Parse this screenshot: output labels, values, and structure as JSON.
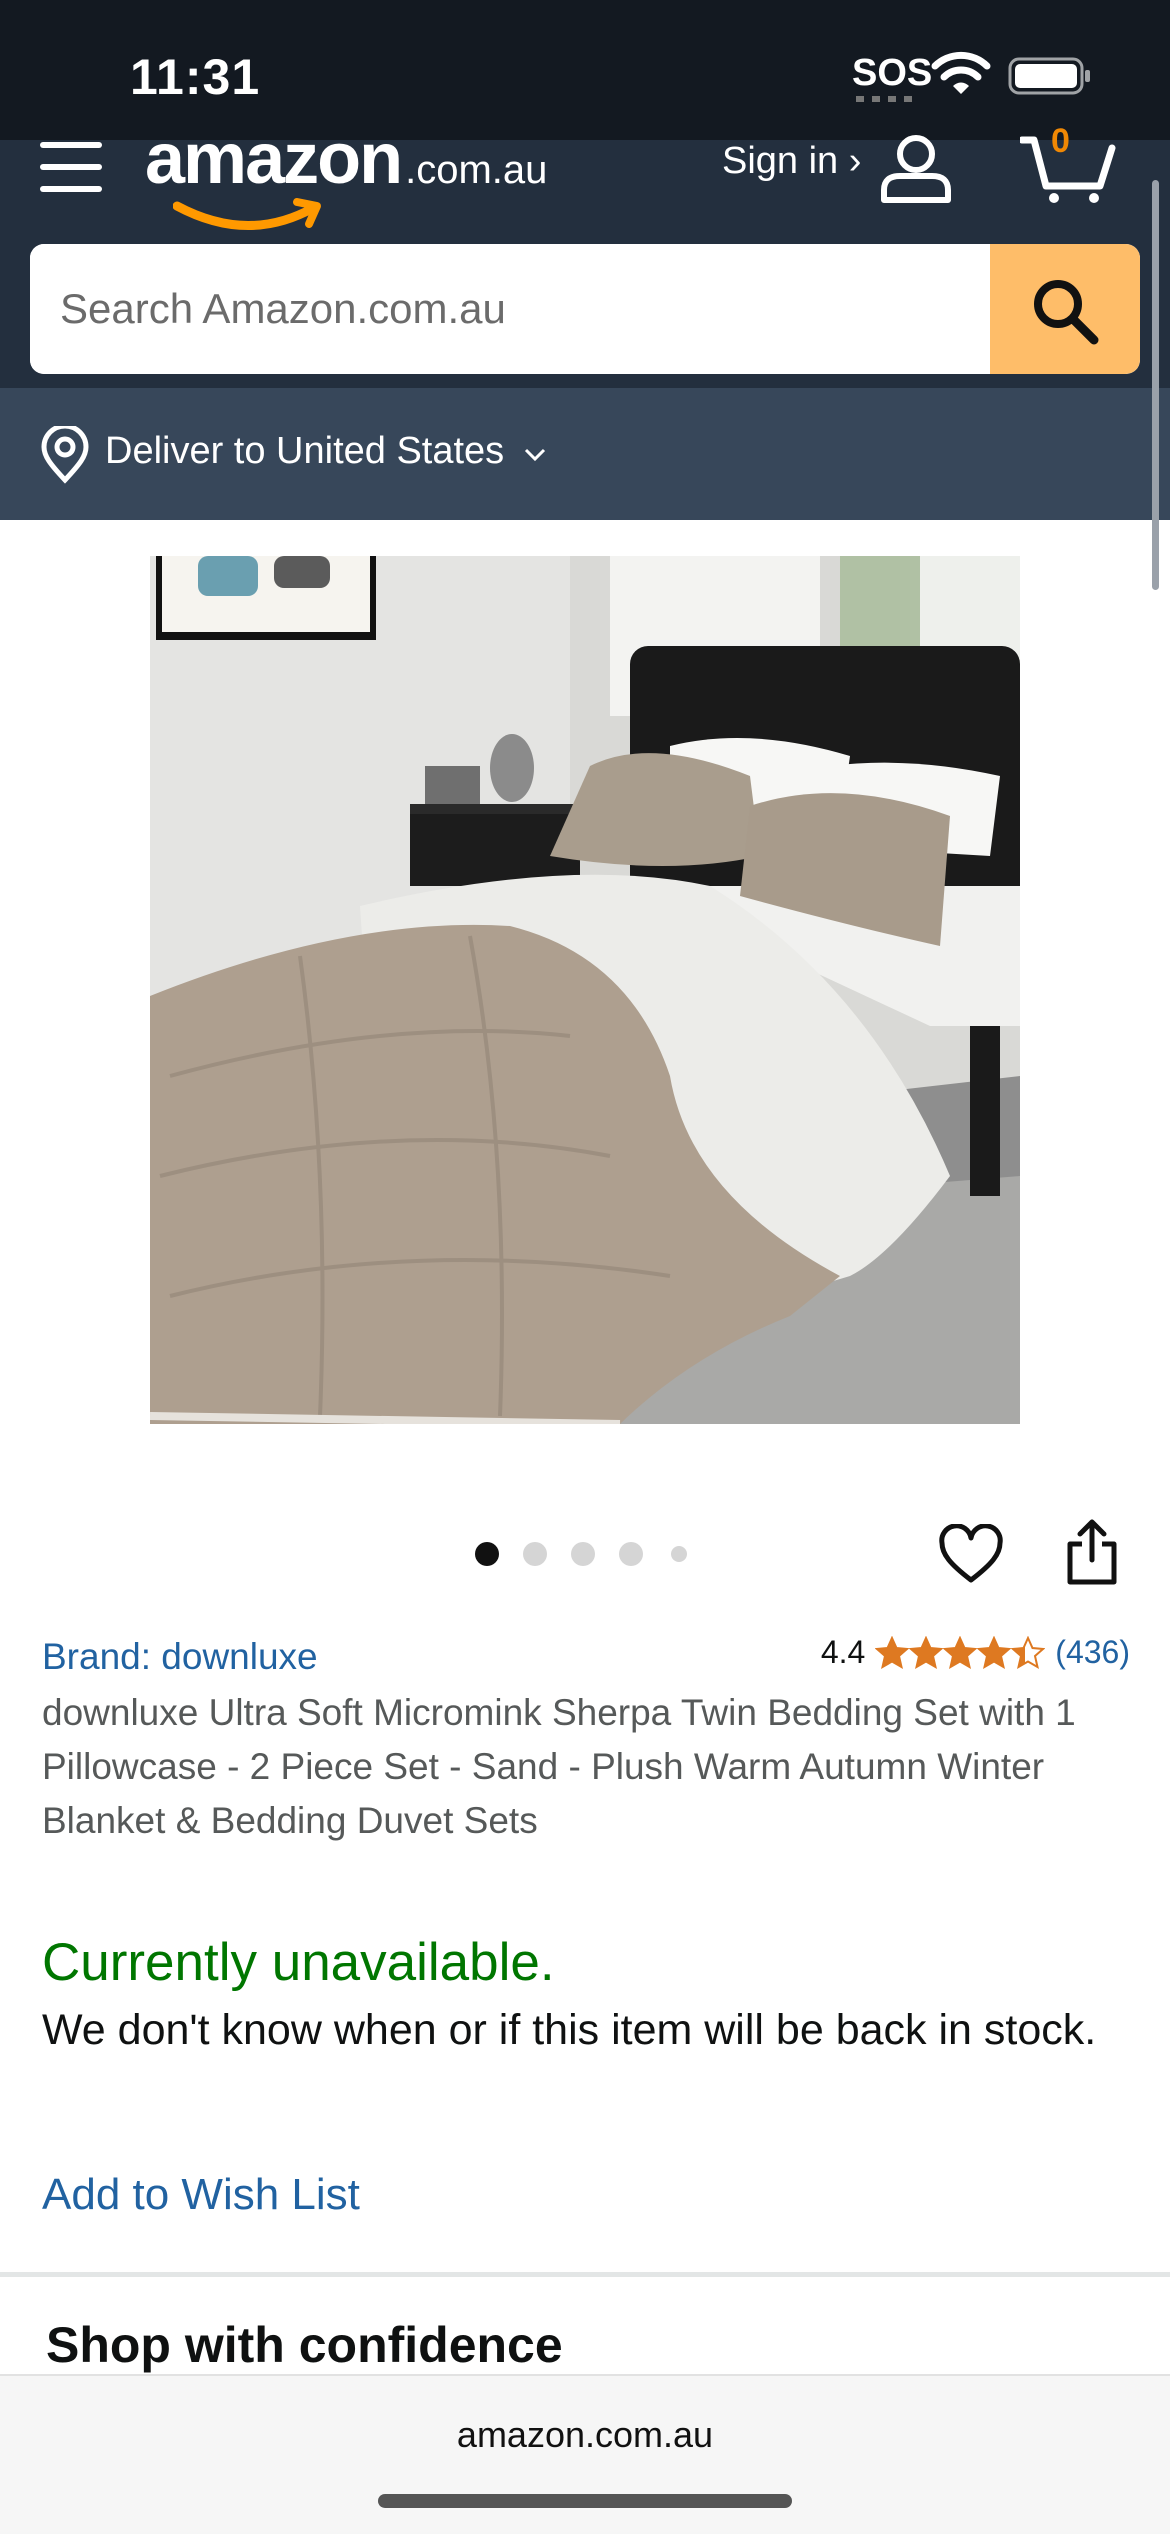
{
  "status_bar": {
    "time": "11:31",
    "sos": "SOS"
  },
  "nav": {
    "logo_word": "amazon",
    "logo_domain": ".com.au",
    "sign_in": "Sign in ›",
    "cart_count": "0"
  },
  "search": {
    "placeholder": "Search Amazon.com.au"
  },
  "deliver": {
    "label": "Deliver to United States"
  },
  "carousel": {
    "image_count": 5,
    "active_index": 0
  },
  "product": {
    "brand": "Brand: downluxe",
    "rating_value": "4.4",
    "rating_stars": 4.4,
    "rating_count": "(436)",
    "title": "downluxe Ultra Soft Micromink Sherpa Twin Bedding Set with 1 Pillowcase - 2 Piece Set - Sand - Plush Warm Autumn Winter Blanket & Bedding Duvet Sets"
  },
  "availability": {
    "status": "Currently unavailable.",
    "note": "We don't know when or if this item will be back in stock."
  },
  "actions": {
    "wishlist": "Add to Wish List"
  },
  "sections": {
    "shop_confidence": "Shop with confidence"
  },
  "browser": {
    "url": "amazon.com.au"
  },
  "colors": {
    "header": "#232f3e",
    "status_bg": "#131921",
    "deliver_bg": "#37475a",
    "search_button": "#febd69",
    "link": "#2162a1",
    "available_green": "#007600",
    "star": "#de7921"
  }
}
